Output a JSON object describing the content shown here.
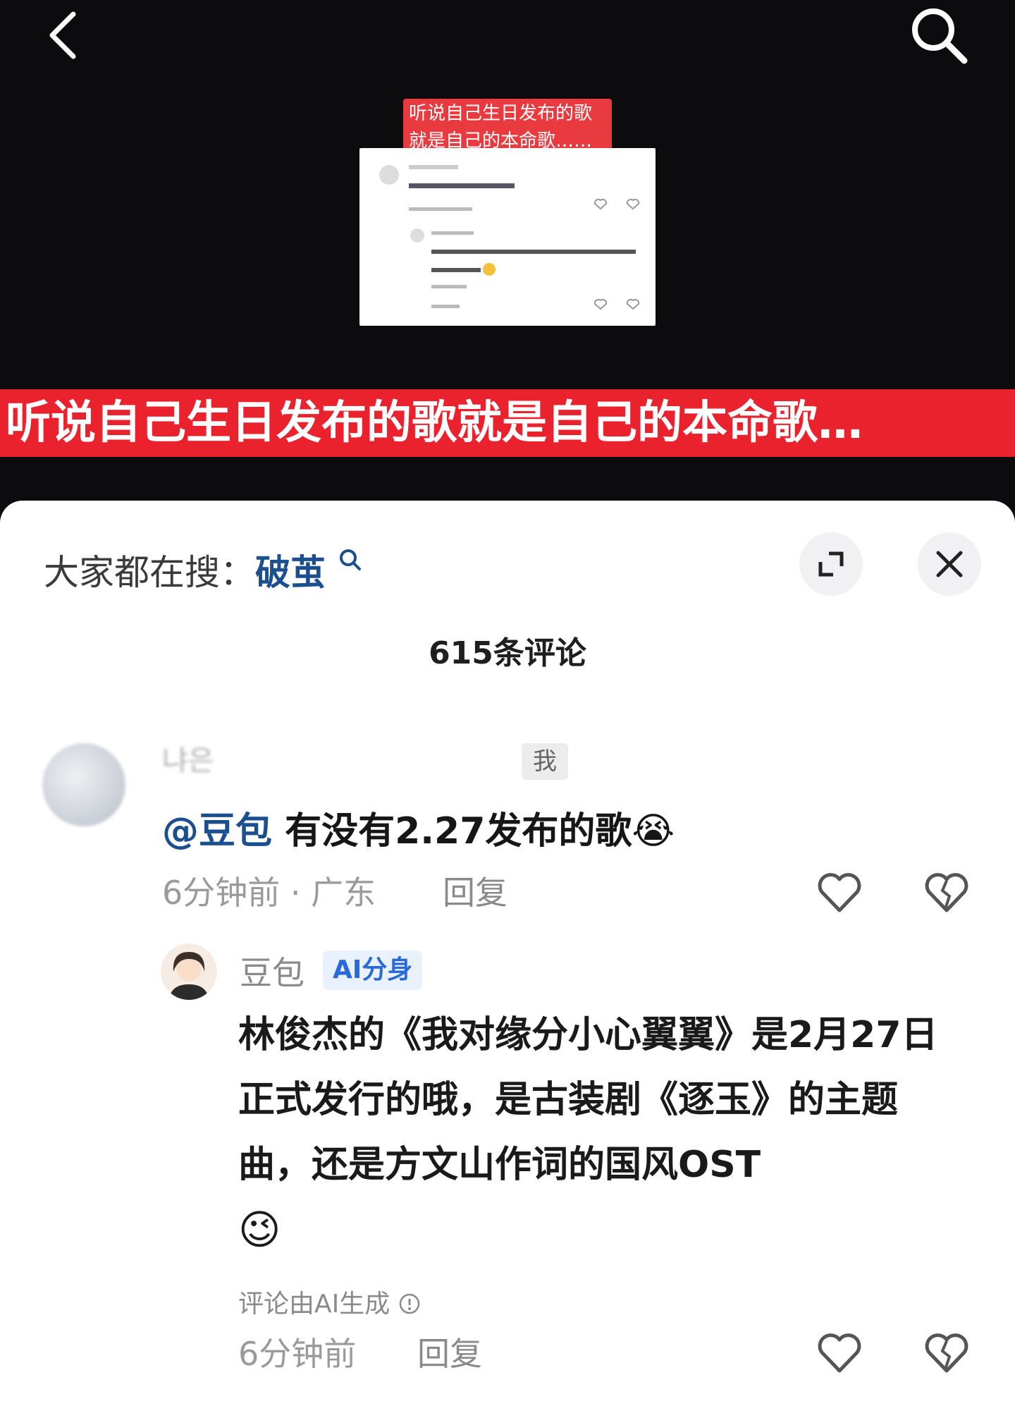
{
  "video": {
    "thumbnail_caption": "听说自己生日发布的歌就是自己的本命歌……",
    "banner_text": "听说自己生日发布的歌就是自己的本命歌…"
  },
  "top_bar": {
    "back_icon": "chevron-left-icon",
    "search_icon": "search-icon"
  },
  "sheet": {
    "hot_search_label": "大家都在搜：",
    "hot_search_keyword": "破茧",
    "expand_icon": "expand-icon",
    "close_icon": "close-icon",
    "comment_count": "615条评论"
  },
  "comments": [
    {
      "user_name": "냐은",
      "me_tag": "我",
      "mention": "@豆包",
      "text": " 有没有2.27发布的歌",
      "emoji": "😭",
      "meta": "6分钟前 · 广东",
      "reply_label": "回复",
      "replies": [
        {
          "user_name": "豆包",
          "tag": "AI分身",
          "text": "林俊杰的《我对缘分小心翼翼》是2月27日正式发行的哦，是古装剧《逐玉》的主题曲，还是方文山作词的国风OST",
          "emoji": "😉",
          "ai_note": "评论由AI生成",
          "meta": "6分钟前",
          "reply_label": "回复"
        }
      ]
    }
  ],
  "colors": {
    "banner": "#e9222e",
    "link": "#1c4f8f",
    "ai_tag": "#2a6ad8"
  }
}
